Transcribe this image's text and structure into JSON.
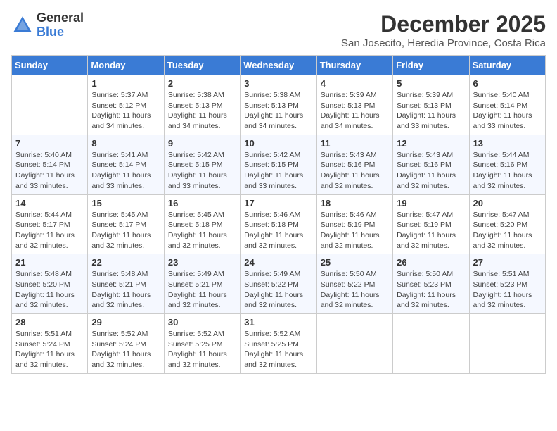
{
  "logo": {
    "general": "General",
    "blue": "Blue"
  },
  "title": "December 2025",
  "subtitle": "San Josecito, Heredia Province, Costa Rica",
  "days_of_week": [
    "Sunday",
    "Monday",
    "Tuesday",
    "Wednesday",
    "Thursday",
    "Friday",
    "Saturday"
  ],
  "weeks": [
    [
      {
        "day": "",
        "info": ""
      },
      {
        "day": "1",
        "info": "Sunrise: 5:37 AM\nSunset: 5:12 PM\nDaylight: 11 hours\nand 34 minutes."
      },
      {
        "day": "2",
        "info": "Sunrise: 5:38 AM\nSunset: 5:13 PM\nDaylight: 11 hours\nand 34 minutes."
      },
      {
        "day": "3",
        "info": "Sunrise: 5:38 AM\nSunset: 5:13 PM\nDaylight: 11 hours\nand 34 minutes."
      },
      {
        "day": "4",
        "info": "Sunrise: 5:39 AM\nSunset: 5:13 PM\nDaylight: 11 hours\nand 34 minutes."
      },
      {
        "day": "5",
        "info": "Sunrise: 5:39 AM\nSunset: 5:13 PM\nDaylight: 11 hours\nand 33 minutes."
      },
      {
        "day": "6",
        "info": "Sunrise: 5:40 AM\nSunset: 5:14 PM\nDaylight: 11 hours\nand 33 minutes."
      }
    ],
    [
      {
        "day": "7",
        "info": "Sunrise: 5:40 AM\nSunset: 5:14 PM\nDaylight: 11 hours\nand 33 minutes."
      },
      {
        "day": "8",
        "info": "Sunrise: 5:41 AM\nSunset: 5:14 PM\nDaylight: 11 hours\nand 33 minutes."
      },
      {
        "day": "9",
        "info": "Sunrise: 5:42 AM\nSunset: 5:15 PM\nDaylight: 11 hours\nand 33 minutes."
      },
      {
        "day": "10",
        "info": "Sunrise: 5:42 AM\nSunset: 5:15 PM\nDaylight: 11 hours\nand 33 minutes."
      },
      {
        "day": "11",
        "info": "Sunrise: 5:43 AM\nSunset: 5:16 PM\nDaylight: 11 hours\nand 32 minutes."
      },
      {
        "day": "12",
        "info": "Sunrise: 5:43 AM\nSunset: 5:16 PM\nDaylight: 11 hours\nand 32 minutes."
      },
      {
        "day": "13",
        "info": "Sunrise: 5:44 AM\nSunset: 5:16 PM\nDaylight: 11 hours\nand 32 minutes."
      }
    ],
    [
      {
        "day": "14",
        "info": "Sunrise: 5:44 AM\nSunset: 5:17 PM\nDaylight: 11 hours\nand 32 minutes."
      },
      {
        "day": "15",
        "info": "Sunrise: 5:45 AM\nSunset: 5:17 PM\nDaylight: 11 hours\nand 32 minutes."
      },
      {
        "day": "16",
        "info": "Sunrise: 5:45 AM\nSunset: 5:18 PM\nDaylight: 11 hours\nand 32 minutes."
      },
      {
        "day": "17",
        "info": "Sunrise: 5:46 AM\nSunset: 5:18 PM\nDaylight: 11 hours\nand 32 minutes."
      },
      {
        "day": "18",
        "info": "Sunrise: 5:46 AM\nSunset: 5:19 PM\nDaylight: 11 hours\nand 32 minutes."
      },
      {
        "day": "19",
        "info": "Sunrise: 5:47 AM\nSunset: 5:19 PM\nDaylight: 11 hours\nand 32 minutes."
      },
      {
        "day": "20",
        "info": "Sunrise: 5:47 AM\nSunset: 5:20 PM\nDaylight: 11 hours\nand 32 minutes."
      }
    ],
    [
      {
        "day": "21",
        "info": "Sunrise: 5:48 AM\nSunset: 5:20 PM\nDaylight: 11 hours\nand 32 minutes."
      },
      {
        "day": "22",
        "info": "Sunrise: 5:48 AM\nSunset: 5:21 PM\nDaylight: 11 hours\nand 32 minutes."
      },
      {
        "day": "23",
        "info": "Sunrise: 5:49 AM\nSunset: 5:21 PM\nDaylight: 11 hours\nand 32 minutes."
      },
      {
        "day": "24",
        "info": "Sunrise: 5:49 AM\nSunset: 5:22 PM\nDaylight: 11 hours\nand 32 minutes."
      },
      {
        "day": "25",
        "info": "Sunrise: 5:50 AM\nSunset: 5:22 PM\nDaylight: 11 hours\nand 32 minutes."
      },
      {
        "day": "26",
        "info": "Sunrise: 5:50 AM\nSunset: 5:23 PM\nDaylight: 11 hours\nand 32 minutes."
      },
      {
        "day": "27",
        "info": "Sunrise: 5:51 AM\nSunset: 5:23 PM\nDaylight: 11 hours\nand 32 minutes."
      }
    ],
    [
      {
        "day": "28",
        "info": "Sunrise: 5:51 AM\nSunset: 5:24 PM\nDaylight: 11 hours\nand 32 minutes."
      },
      {
        "day": "29",
        "info": "Sunrise: 5:52 AM\nSunset: 5:24 PM\nDaylight: 11 hours\nand 32 minutes."
      },
      {
        "day": "30",
        "info": "Sunrise: 5:52 AM\nSunset: 5:25 PM\nDaylight: 11 hours\nand 32 minutes."
      },
      {
        "day": "31",
        "info": "Sunrise: 5:52 AM\nSunset: 5:25 PM\nDaylight: 11 hours\nand 32 minutes."
      },
      {
        "day": "",
        "info": ""
      },
      {
        "day": "",
        "info": ""
      },
      {
        "day": "",
        "info": ""
      }
    ]
  ]
}
